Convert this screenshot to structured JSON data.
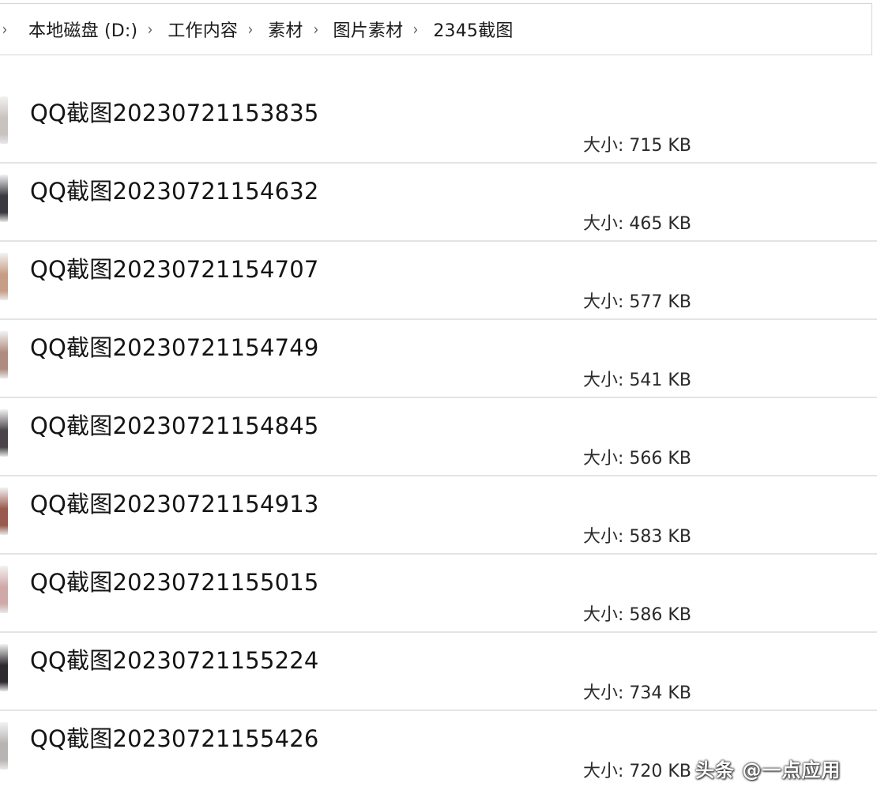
{
  "breadcrumb": {
    "items": [
      "本地磁盘 (D:)",
      "工作内容",
      "素材",
      "图片素材",
      "2345截图"
    ],
    "separator": "›"
  },
  "files": [
    {
      "name": "QQ截图20230721153835",
      "size_label": "大小:",
      "size": "715 KB",
      "thumb_color": "#c9c3c0"
    },
    {
      "name": "QQ截图20230721154632",
      "size_label": "大小:",
      "size": "465 KB",
      "thumb_color": "#3a3a40"
    },
    {
      "name": "QQ截图20230721154707",
      "size_label": "大小:",
      "size": "577 KB",
      "thumb_color": "#c89d86"
    },
    {
      "name": "QQ截图20230721154749",
      "size_label": "大小:",
      "size": "541 KB",
      "thumb_color": "#b08c80"
    },
    {
      "name": "QQ截图20230721154845",
      "size_label": "大小:",
      "size": "566 KB",
      "thumb_color": "#4a4448"
    },
    {
      "name": "QQ截图20230721154913",
      "size_label": "大小:",
      "size": "583 KB",
      "thumb_color": "#9a5a4e"
    },
    {
      "name": "QQ截图20230721155015",
      "size_label": "大小:",
      "size": "586 KB",
      "thumb_color": "#d0a8a8"
    },
    {
      "name": "QQ截图20230721155224",
      "size_label": "大小:",
      "size": "734 KB",
      "thumb_color": "#2e2a30"
    },
    {
      "name": "QQ截图20230721155426",
      "size_label": "大小:",
      "size": "720 KB",
      "thumb_color": "#b9b4b4"
    }
  ],
  "watermark": "头条 @一点应用"
}
